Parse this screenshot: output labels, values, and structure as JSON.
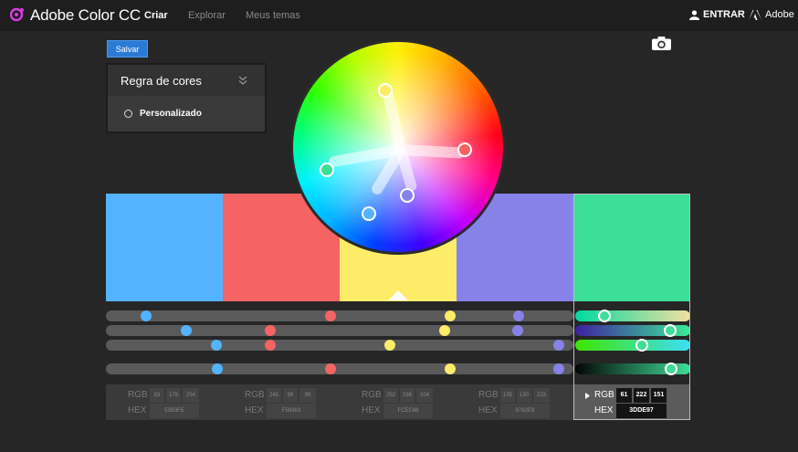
{
  "header": {
    "app_title": "Adobe Color CC",
    "nav": [
      "Criar",
      "Explorar",
      "Meus temas"
    ],
    "active_nav": "Criar",
    "login_label": "ENTRAR",
    "brand_label": "Adobe"
  },
  "toolbar": {
    "save_label": "Salvar"
  },
  "color_rule": {
    "title": "Regra de cores",
    "selected_option": "Personalizado"
  },
  "colors": {
    "selected_index": 4,
    "swatches": [
      {
        "hex": "#53B3FE",
        "rgb": [
          "83",
          "179",
          "254"
        ],
        "hex_label": "53B3FE"
      },
      {
        "hex": "#F56363",
        "rgb": [
          "245",
          "99",
          "99"
        ],
        "hex_label": "F56363"
      },
      {
        "hex": "#FCEC68",
        "rgb": [
          "252",
          "236",
          "104"
        ],
        "hex_label": "FCEC68"
      },
      {
        "hex": "#8782E9",
        "rgb": [
          "135",
          "130",
          "233"
        ],
        "hex_label": "8782E9"
      },
      {
        "hex": "#3DDE97",
        "rgb": [
          "61",
          "222",
          "151"
        ],
        "hex_label": "3DDE97"
      }
    ],
    "rgb_label": "RGB",
    "hex_label": "HEX"
  },
  "icons": {
    "logo": "color-wheel-logo-icon",
    "user": "user-icon",
    "adobe": "adobe-logo-icon",
    "camera": "camera-icon",
    "chevron": "chevron-double-down-icon",
    "radio": "radio-icon",
    "disclosure": "triangle-right-icon"
  }
}
